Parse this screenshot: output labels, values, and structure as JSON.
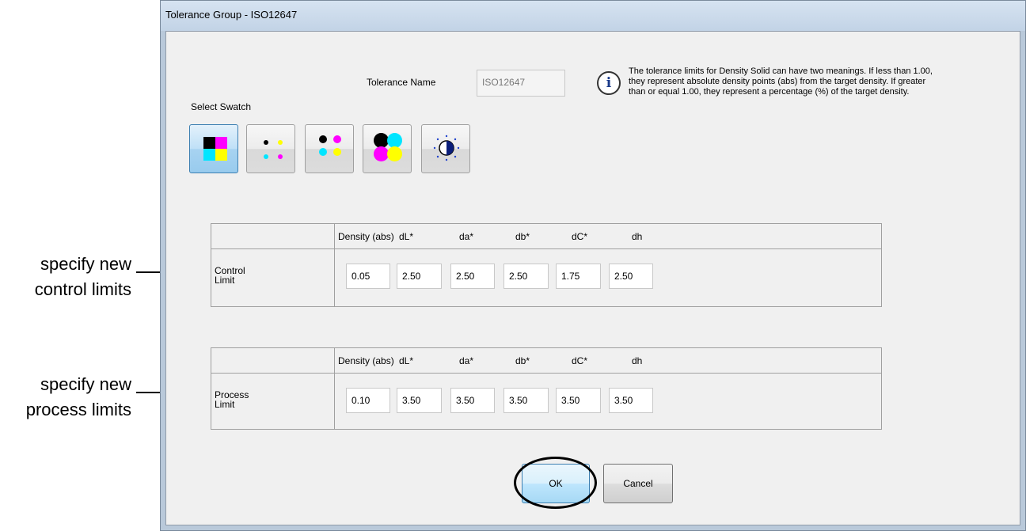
{
  "window": {
    "title": "Tolerance Group - ISO12647"
  },
  "tolerance_name": {
    "label": "Tolerance Name",
    "value": "ISO12647"
  },
  "select_swatch": {
    "label": "Select Swatch"
  },
  "info": {
    "icon": "info-icon",
    "lines": [
      "The tolerance limits for Density Solid can have two meanings. If less than 1.00,",
      "they represent absolute density points (abs) from the target density. If greater",
      "than or equal 1.00, they represent a percentage (%) of the target density."
    ]
  },
  "swatches": [
    {
      "name": "solid-squares-swatch-icon",
      "selected": true
    },
    {
      "name": "small-dots-swatch-icon",
      "selected": false
    },
    {
      "name": "medium-dots-swatch-icon",
      "selected": false
    },
    {
      "name": "large-dots-swatch-icon",
      "selected": false
    },
    {
      "name": "contrast-swatch-icon",
      "selected": false
    }
  ],
  "columns": [
    "Density (abs)",
    "dL*",
    "da*",
    "db*",
    "dC*",
    "dh"
  ],
  "control": {
    "label_line1": "Control",
    "label_line2": "Limit",
    "values": [
      "0.05",
      "2.50",
      "2.50",
      "2.50",
      "1.75",
      "2.50"
    ]
  },
  "process": {
    "label_line1": "Process",
    "label_line2": "Limit",
    "values": [
      "0.10",
      "3.50",
      "3.50",
      "3.50",
      "3.50",
      "3.50"
    ]
  },
  "buttons": {
    "ok": "OK",
    "cancel": "Cancel"
  },
  "annotations": {
    "control_line1": "specify new",
    "control_line2": "control limits",
    "process_line1": "specify new",
    "process_line2": "process limits"
  },
  "colors": {
    "cyan": "#00e5ff",
    "magenta": "#ff00ff",
    "yellow": "#ffff00",
    "black": "#000000"
  }
}
